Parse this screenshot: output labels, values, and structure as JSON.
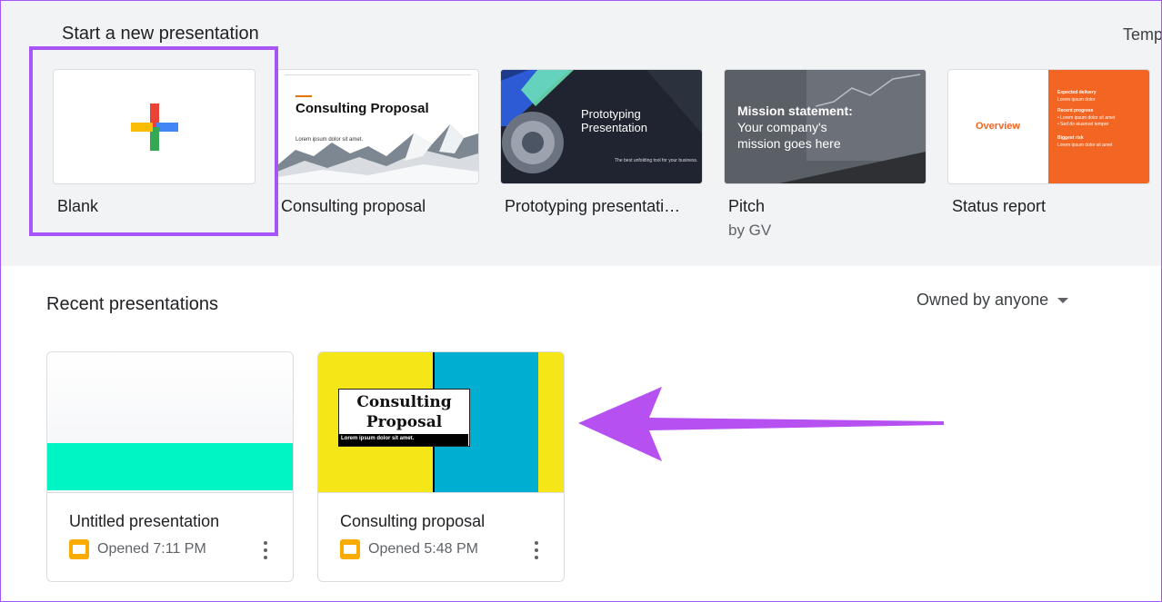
{
  "gallery": {
    "title": "Start a new presentation",
    "template_gallery_link": "Temp",
    "templates": [
      {
        "name": "Blank"
      },
      {
        "name": "Consulting proposal",
        "thumb_title": "Consulting Proposal",
        "thumb_sub": "Lorem ipsum dolor sit amet."
      },
      {
        "name": "Prototyping presentati…",
        "thumb_title": "Prototyping Presentation",
        "thumb_footer": "The best unfolding tool for your business."
      },
      {
        "name": "Pitch",
        "by": "by GV",
        "thumb_bold": "Mission statement:",
        "thumb_text": "Your company's mission goes here"
      },
      {
        "name": "Status report",
        "thumb_left": "Overview",
        "thumb_right": [
          "Expected delivery",
          "Lorem ipsum dolor",
          "Recent progress",
          "• Lorem ipsum dolor sit amet",
          "• Sed do eiusmod tempor",
          "Biggest risk",
          "Lorem ipsum dolor sit amet"
        ]
      }
    ]
  },
  "recent": {
    "title": "Recent presentations",
    "owner_filter": "Owned by anyone",
    "docs": [
      {
        "name": "Untitled presentation",
        "opened": "Opened 7:11 PM"
      },
      {
        "name": "Consulting proposal",
        "opened": "Opened 5:48 PM",
        "thumb_title": "Consulting Proposal",
        "thumb_sub": "Lorem ipsum dolor sit amet."
      }
    ]
  },
  "colors": {
    "highlight": "#a855f7",
    "gallery_bg": "#f1f3f4",
    "teal": "#00f5c4",
    "yellow": "#f5e617",
    "cyan": "#00aed1",
    "orange": "#f26522",
    "slides_yellow": "#f9ab00"
  },
  "icons": [
    "plus-multicolor-icon",
    "slides-icon",
    "more-vert-icon",
    "dropdown-caret-icon",
    "annotation-arrow"
  ]
}
